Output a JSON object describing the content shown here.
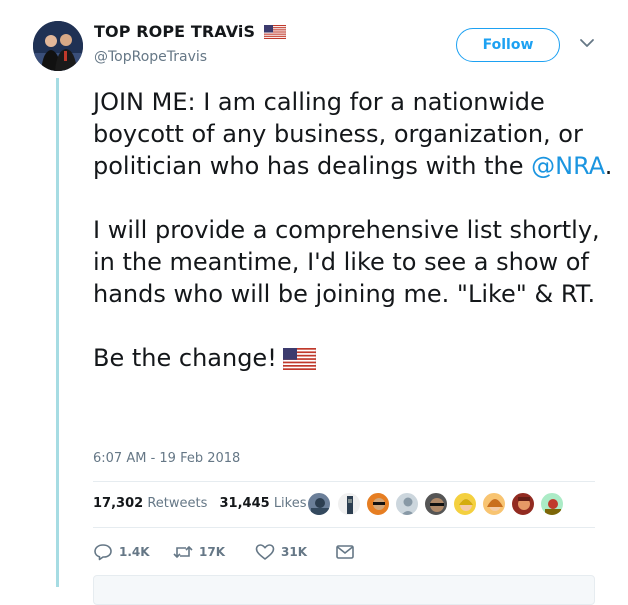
{
  "author": {
    "display_name": "TOP ROPE TRAViS",
    "handle": "@TopRopeTravis",
    "name_emoji": "us-flag-icon"
  },
  "follow_label": "Follow",
  "tweet": {
    "line1_before": "JOIN ME: I am calling for a nationwide boycott of any business, organization, or politician who has dealings with the ",
    "mention": "@NRA",
    "line1_after": ".",
    "paragraph2": "I will provide a comprehensive list shortly, in the meantime, I'd like to see a show of hands who will be joining me. \"Like\" & RT.",
    "paragraph3": "Be the change!"
  },
  "timestamp": "6:07 AM - 19 Feb 2018",
  "stats": {
    "retweets_count": "17,302",
    "retweets_label": "Retweets",
    "likes_count": "31,445",
    "likes_label": "Likes"
  },
  "actions": {
    "replies": "1.4K",
    "retweets": "17K",
    "likes": "31K"
  },
  "colors": {
    "accent": "#1da1f2",
    "mention": "#1b95e0",
    "muted": "#657786",
    "thread_line": "#a6dce3"
  }
}
